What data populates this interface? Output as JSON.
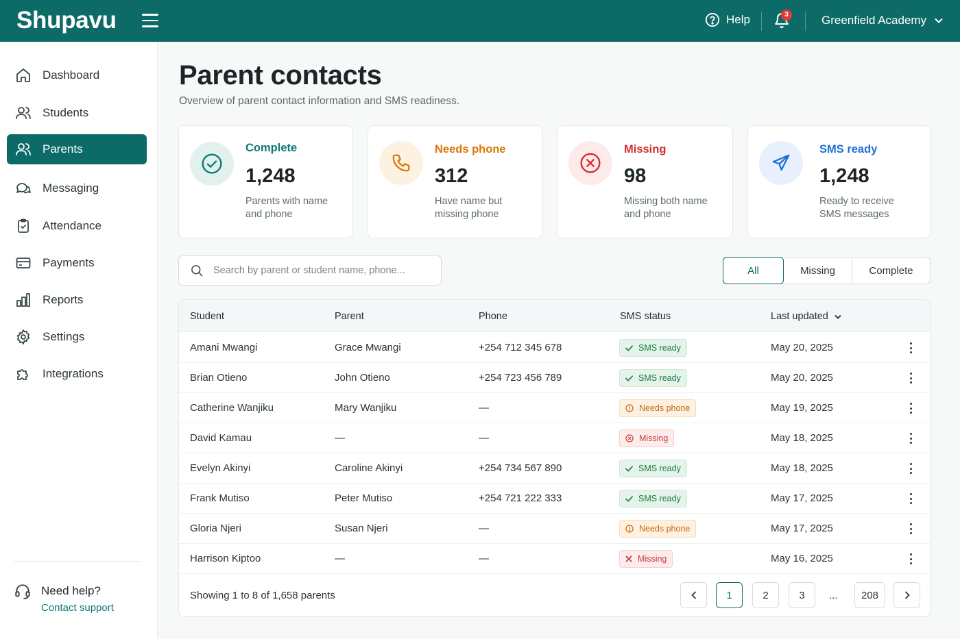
{
  "app": {
    "brand": "Shupavu"
  },
  "topbar": {
    "help_label": "Help",
    "notification_count": "3",
    "org_name": "Greenfield Academy"
  },
  "sidebar": {
    "items": [
      {
        "label": "Dashboard",
        "icon": "home-icon"
      },
      {
        "label": "Students",
        "icon": "users-icon"
      },
      {
        "label": "Parents",
        "icon": "users-icon",
        "active": true
      },
      {
        "label": "Messaging",
        "icon": "chat-icon"
      },
      {
        "label": "Attendance",
        "icon": "clipboard-check-icon"
      },
      {
        "label": "Payments",
        "icon": "credit-card-icon"
      },
      {
        "label": "Reports",
        "icon": "bar-chart-icon"
      },
      {
        "label": "Settings",
        "icon": "gear-icon"
      },
      {
        "label": "Integrations",
        "icon": "puzzle-icon"
      }
    ],
    "support_title": "Need help?",
    "support_link": "Contact support"
  },
  "page": {
    "title": "Parent contacts",
    "subtitle": "Overview of parent contact information and SMS readiness."
  },
  "cards": [
    {
      "label": "Complete",
      "value": "1,248",
      "desc": "Parents with name and phone",
      "color": "#0d7a74",
      "icon": "check-circle-icon"
    },
    {
      "label": "Needs phone",
      "value": "312",
      "desc": "Have name but missing phone",
      "color": "#d97706",
      "icon": "phone-icon"
    },
    {
      "label": "Missing",
      "value": "98",
      "desc": "Missing both name and phone",
      "color": "#d32f2f",
      "icon": "x-circle-icon"
    },
    {
      "label": "SMS ready",
      "value": "1,248",
      "desc": "Ready to receive SMS messages",
      "color": "#1d6fd6",
      "icon": "send-icon"
    }
  ],
  "search": {
    "placeholder": "Search by parent or student name, phone..."
  },
  "filters": [
    "All",
    "Missing",
    "Complete"
  ],
  "table": {
    "columns": [
      "Student",
      "Parent",
      "Phone",
      "SMS status",
      "Last updated"
    ],
    "rows": [
      {
        "student": "Amani Mwangi",
        "parent": "Grace Mwangi",
        "phone": "+254 712 345 678",
        "status": "SMS ready",
        "kind": "ready",
        "updated": "May 20, 2025"
      },
      {
        "student": "Brian Otieno",
        "parent": "John Otieno",
        "phone": "+254 723 456 789",
        "status": "SMS ready",
        "kind": "ready",
        "updated": "May 20, 2025"
      },
      {
        "student": "Catherine Wanjiku",
        "parent": "Mary Wanjiku",
        "phone": "—",
        "status": "Needs phone",
        "kind": "needs",
        "updated": "May 19, 2025"
      },
      {
        "student": "David Kamau",
        "parent": "—",
        "phone": "—",
        "status": "Missing",
        "kind": "missing",
        "updated": "May 18, 2025"
      },
      {
        "student": "Evelyn Akinyi",
        "parent": "Caroline Akinyi",
        "phone": "+254 734 567 890",
        "status": "SMS ready",
        "kind": "ready",
        "updated": "May 18, 2025"
      },
      {
        "student": "Frank Mutiso",
        "parent": "Peter Mutiso",
        "phone": "+254 721 222 333",
        "status": "SMS ready",
        "kind": "ready",
        "updated": "May 17, 2025"
      },
      {
        "student": "Gloria Njeri",
        "parent": "Susan Njeri",
        "phone": "—",
        "status": "Needs phone",
        "kind": "needs",
        "updated": "May 17, 2025"
      },
      {
        "student": "Harrison Kiptoo",
        "parent": "—",
        "phone": "—",
        "status": "Missing",
        "kind": "missing-x",
        "updated": "May 16, 2025"
      }
    ],
    "footer": "Showing 1 to 8 of 1,658 parents"
  },
  "pagination": {
    "pages": [
      "1",
      "2",
      "3"
    ],
    "ellipsis": "...",
    "last": "208",
    "current": "1"
  }
}
